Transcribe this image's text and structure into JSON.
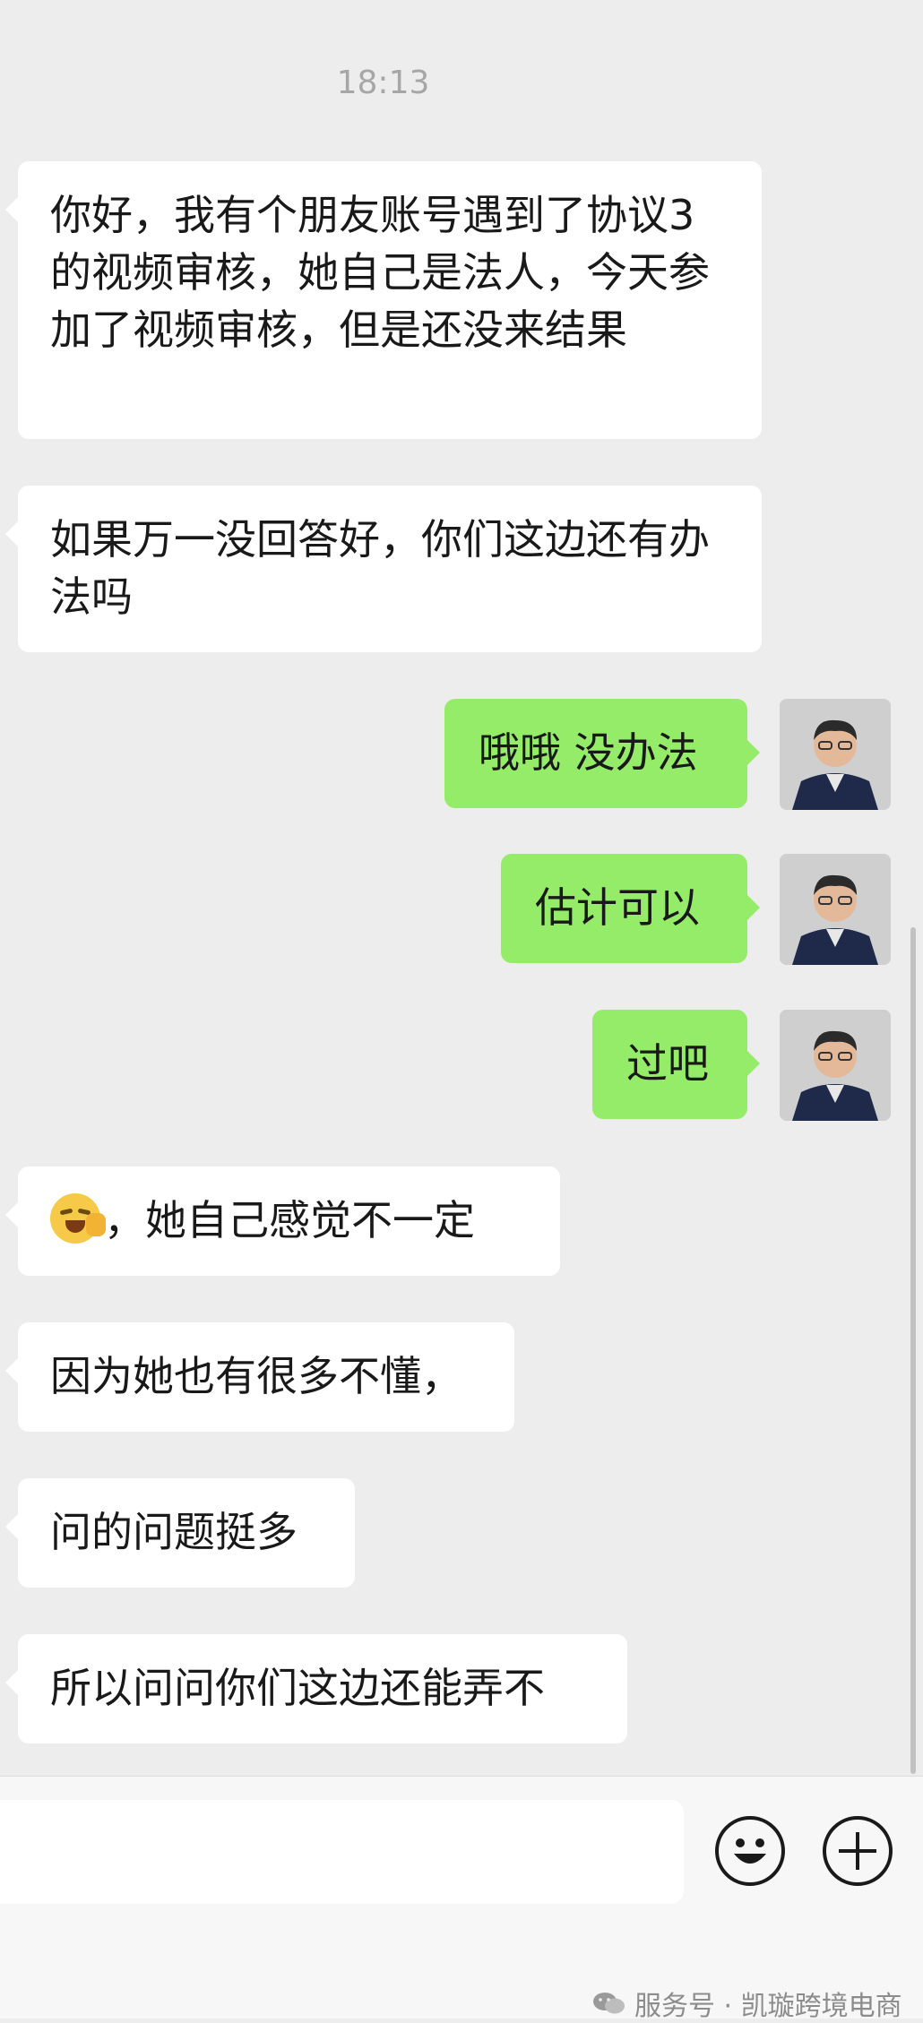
{
  "chat": {
    "timestamp": "18:13",
    "messages": [
      {
        "side": "in",
        "text": "你好，我有个朋友账号遇到了协议3的视频审核，她自己是法人，今天参加了视频审核，但是还没来结果"
      },
      {
        "side": "in",
        "text": "如果万一没回答好，你们这边还有办法吗"
      },
      {
        "side": "out",
        "text": "哦哦 没办法"
      },
      {
        "side": "out",
        "text": "估计可以"
      },
      {
        "side": "out",
        "text": "过吧"
      },
      {
        "side": "in",
        "emoji": "face-palm-emoji",
        "text": "，她自己感觉不一定"
      },
      {
        "side": "in",
        "text": "因为她也有很多不懂，"
      },
      {
        "side": "in",
        "text": "问的问题挺多"
      },
      {
        "side": "in",
        "text": "所以问问你们这边还能弄不"
      }
    ]
  },
  "input_bar": {
    "buttons": [
      "emoji-button",
      "plus-button"
    ]
  },
  "watermark": {
    "text": "服务号 · 凯璇跨境电商"
  },
  "colors": {
    "background": "#ededed",
    "incoming_bubble": "#ffffff",
    "outgoing_bubble": "#95ec69"
  }
}
